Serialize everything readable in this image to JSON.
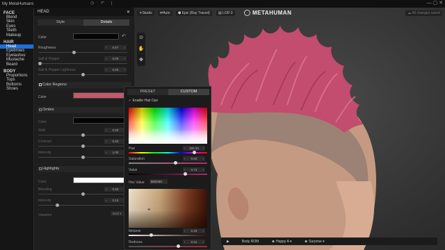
{
  "titlebar": {
    "title": "My MetaHumans",
    "center_icons": [
      "◷",
      "↶",
      "|"
    ]
  },
  "sidebar": {
    "sections": [
      {
        "title": "FACE",
        "items": [
          "Blend",
          "Skin",
          "Eyes",
          "Teeth",
          "Makeup"
        ]
      },
      {
        "title": "HAIR",
        "items": [
          "Head",
          "Eyebrows",
          "Eyelashes",
          "Mustache",
          "Beard"
        ]
      },
      {
        "title": "BODY",
        "items": [
          "Proportions",
          "Tops",
          "Bottoms",
          "Shoes"
        ]
      }
    ],
    "active": "Head"
  },
  "panel": {
    "header": "HEAD",
    "close": "✕",
    "tabs": [
      "Style",
      "Details"
    ],
    "active_tab": "Details",
    "color_label": "Color",
    "color_value": "#050505",
    "rows": [
      {
        "label": "Roughness",
        "value": "0.67",
        "fill": 0.4,
        "dim": false
      },
      {
        "label": "Salt & Pepper",
        "value": "0.00",
        "fill": 0.0,
        "dim": true
      },
      {
        "label": "Salt & Pepper Lightness",
        "value": "0.50",
        "fill": 0.5,
        "dim": true
      }
    ],
    "regions": {
      "header": "Color Regions",
      "color_label": "Color",
      "color_value": "#c35a6c",
      "ombre": {
        "header": "Ombre",
        "color_label": "Color",
        "color_value": "#050505",
        "rows": [
          {
            "label": "Shift",
            "value": "0.50"
          },
          {
            "label": "Contrast",
            "value": "0.50"
          },
          {
            "label": "Intensity",
            "value": "1.00"
          }
        ]
      },
      "highlights": {
        "header": "Highlights",
        "color_label": "Color",
        "color_value": "#ffffff",
        "rows": [
          {
            "label": "Blending",
            "value": "0.50"
          },
          {
            "label": "Intensity",
            "value": "0.10"
          }
        ],
        "variation_label": "Variation",
        "variation_value": "Bold"
      }
    }
  },
  "viewport": {
    "buttons": [
      "Studio",
      "Auto",
      "Epic (Ray Traced)",
      "LOD 0"
    ],
    "brand": "METAHUMAN",
    "saved": "All changes saved",
    "tools": [
      "⊙",
      "✋",
      "✥"
    ],
    "bottom": [
      "Body ROM",
      "Happy A",
      "Surprise"
    ]
  },
  "picker": {
    "tabs": [
      "PRESET",
      "CUSTOM"
    ],
    "active_tab": "CUSTOM",
    "enable_label": "Enable Hair Dye",
    "hue": {
      "label": "Hue",
      "value": "306.35",
      "fill": 0.85
    },
    "saturation": {
      "label": "Saturation",
      "value": "0.60",
      "fill": 0.6
    },
    "value": {
      "label": "Value",
      "value": "0.73",
      "fill": 0.73
    },
    "hex_label": "Hex Value",
    "hex_value": "B32A6A",
    "melanin": {
      "label": "Melanin",
      "value": "0.28",
      "fill": 0.28
    },
    "redness": {
      "label": "Redness",
      "value": "0.64",
      "fill": 0.64
    }
  },
  "colors": {
    "accent": "#1e6fd9",
    "hair": "#c35a6c"
  }
}
